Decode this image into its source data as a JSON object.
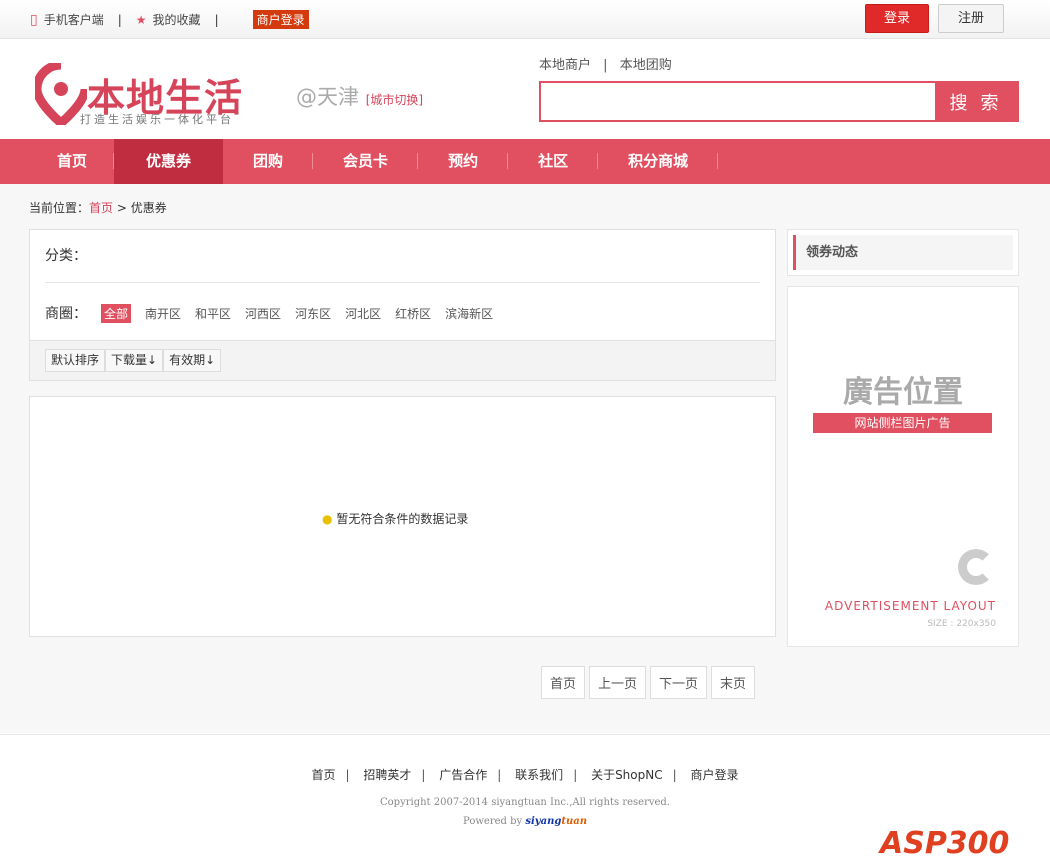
{
  "topbar": {
    "mobile": "手机客户端",
    "favorites": "我的收藏",
    "merchant_login": "商户登录",
    "login": "登录",
    "register": "注册"
  },
  "header": {
    "logo_text": "本地生活",
    "slogan": "打造生活娱乐一体化平台",
    "city": "@天津",
    "city_switch": "[城市切换]",
    "link1": "本地商户",
    "link2": "本地团购",
    "search_button": "搜 索",
    "search_value": ""
  },
  "nav": [
    "首页",
    "优惠券",
    "团购",
    "会员卡",
    "预约",
    "社区",
    "积分商城"
  ],
  "breadcrumb": {
    "label": "当前位置：",
    "home": "首页",
    "sep": ">",
    "current": "优惠券"
  },
  "filter": {
    "category_label": "分类：",
    "area_label": "商圈：",
    "areas": [
      "全部",
      "南开区",
      "和平区",
      "河西区",
      "河东区",
      "河北区",
      "红桥区",
      "滨海新区"
    ],
    "sorts": [
      "默认排序",
      "下载量↓",
      "有效期↓"
    ]
  },
  "results": {
    "empty": "暂无符合条件的数据记录"
  },
  "sidebar": {
    "title": "领券动态",
    "ad_big": "廣告位置",
    "ad_bar": "网站侧栏图片广告",
    "ad_layout": "ADVERTISEMENT  LAYOUT",
    "ad_size": "SIZE : 220x350"
  },
  "pager": [
    "首页",
    "上一页",
    "下一页",
    "末页"
  ],
  "footer": {
    "links": [
      "首页",
      "招聘英才",
      "广告合作",
      "联系我们",
      "关于ShopNC",
      "商户登录"
    ],
    "copyright": "Copyright 2007-2014 siyangtuan Inc.,All rights reserved.",
    "powered": "Powered by ",
    "brand1": "siyang",
    "brand2": "tuan",
    "watermark": "ASP300"
  }
}
